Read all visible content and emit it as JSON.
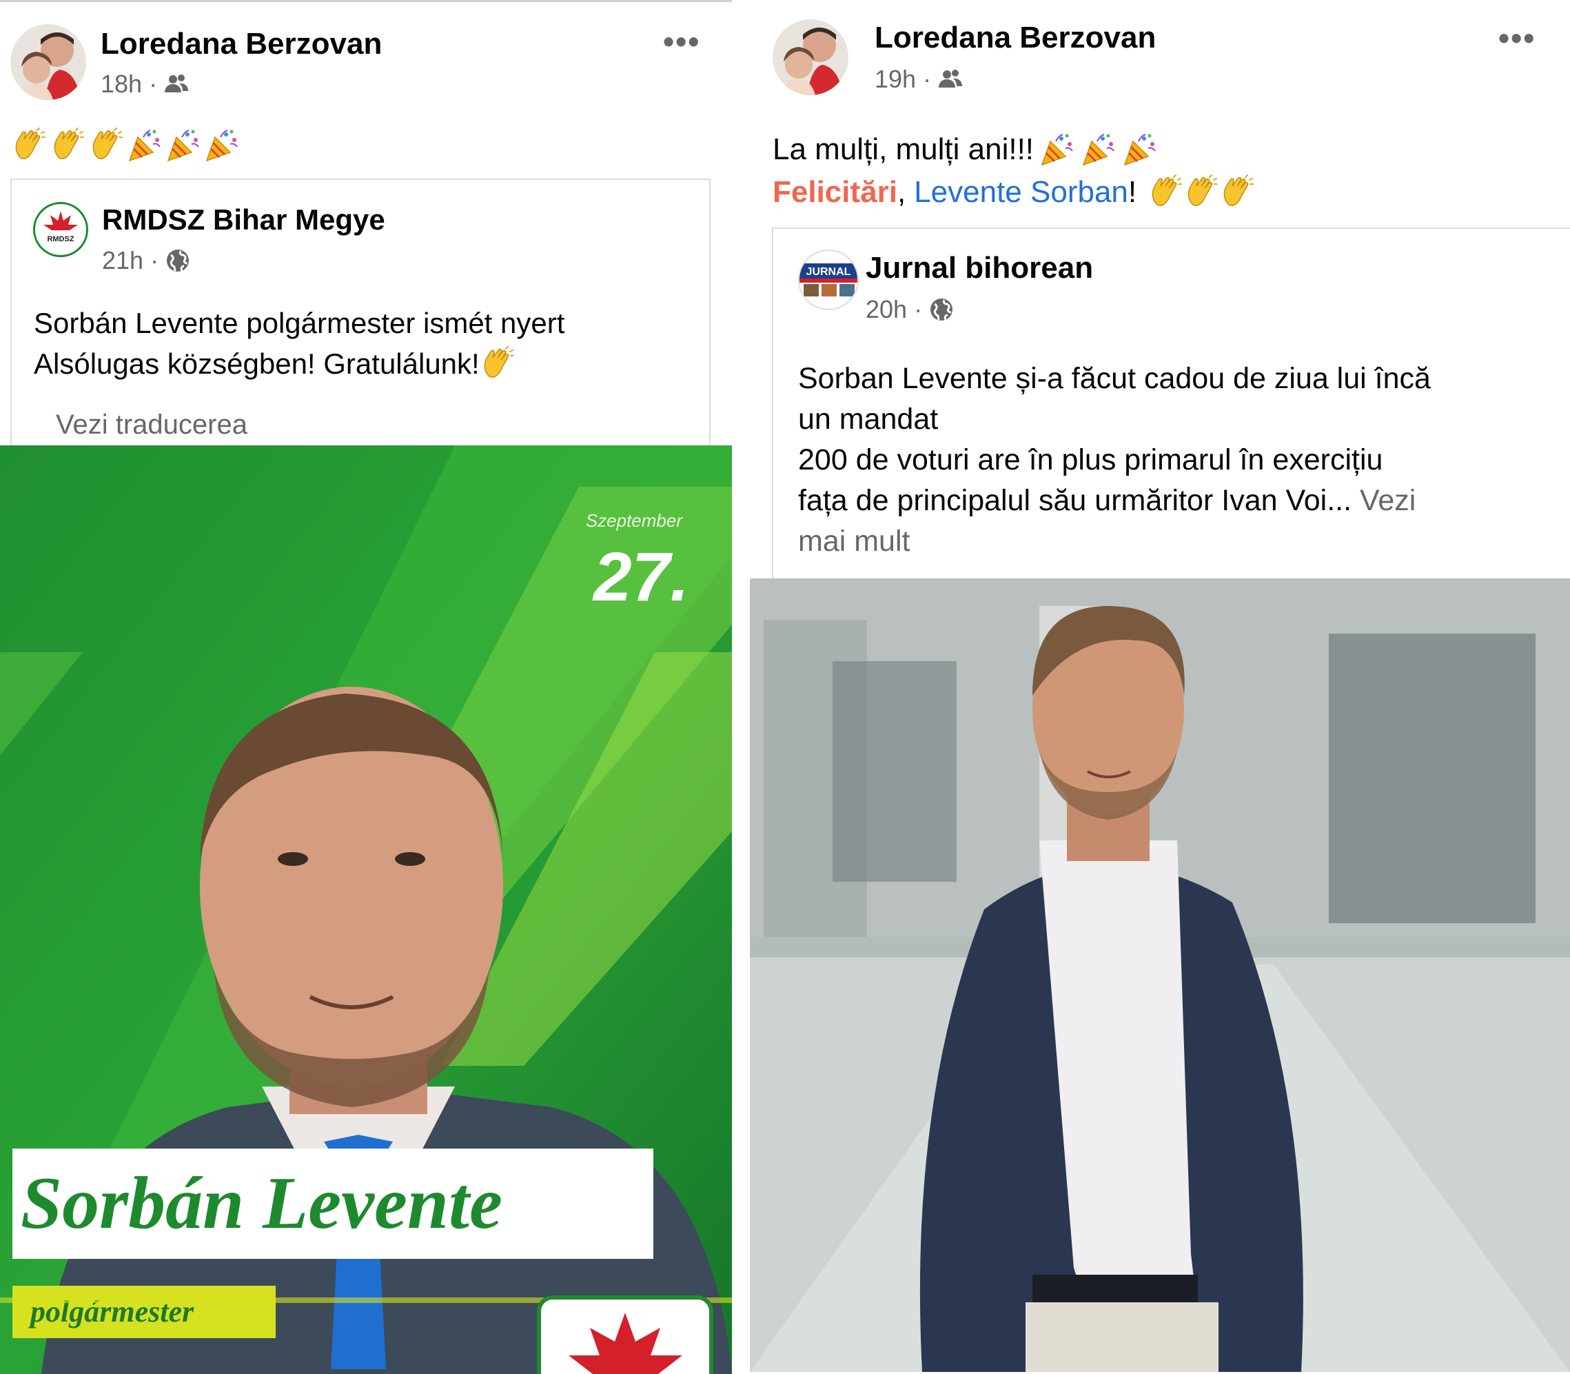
{
  "left_post": {
    "author": "Loredana Berzovan",
    "time": "18h",
    "emojis": [
      "clap",
      "clap",
      "clap",
      "party",
      "party",
      "party"
    ],
    "shared": {
      "page_name": "RMDSZ Bihar Megye",
      "logo_text": "RMDSZ",
      "time": "21h",
      "text_line1": "Sorbán Levente polgármester ismét nyert",
      "text_line2": "Alsólugas községben! Gratulálunk!",
      "translate": "Vezi traducerea",
      "poster": {
        "date_label": "Szeptember",
        "date_number": "27.",
        "name": "Sorbán Levente",
        "role": "polgármester"
      }
    }
  },
  "right_post": {
    "author": "Loredana Berzovan",
    "time": "19h",
    "line1": "La mulți, mulți ani!!!",
    "felicitari": "Felicitări",
    "comma": ",",
    "mention": "Levente Sorban",
    "excl": "!",
    "shared": {
      "page_name": "Jurnal bihorean",
      "logo_text": "JURNAL",
      "time": "20h",
      "line1": "Sorban Levente și-a făcut cadou de ziua lui încă",
      "line2": "un mandat",
      "line3": "200 de voturi are în plus  primarul în exercițiu",
      "line4": "fața de principalul său urmăritor Ivan Voi...",
      "see_more_a": "Vezi",
      "see_more_b": "mai mult"
    }
  },
  "icons": {
    "audience": "friends-icon",
    "public": "globe-icon",
    "more": "more-options-icon"
  },
  "colors": {
    "rmdsz_green": "#1e8a2e",
    "rmdsz_red": "#d3202a",
    "link_blue": "#216fdb",
    "mention_red": "#f0674f"
  }
}
